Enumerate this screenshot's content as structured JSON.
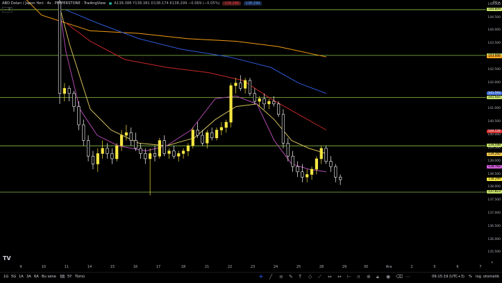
{
  "legend": {
    "symbol": "ABD Doları / Japon Yeni · 4s · PEPPERSTONE · TradingView",
    "ohlc": "A138.388 Y138.381 D138.174 K138.299 −0.069 (−0.05%)",
    "sell": "138.288",
    "buy": "138.299"
  },
  "collapse_label": "⌄ 3",
  "axis_symbol": "JPY ▾",
  "price_ticks": [
    "145.000",
    "144.500",
    "144.000",
    "143.500",
    "143.000",
    "142.500",
    "142.000",
    "141.500",
    "141.000",
    "140.500",
    "140.000",
    "139.500",
    "139.000",
    "138.500",
    "138.000",
    "137.500",
    "137.000",
    "136.500",
    "136.000",
    "135.500"
  ],
  "price_tags": [
    {
      "text": "144.809",
      "color": "#c6e06a",
      "fg": "#000"
    },
    {
      "text": "143.059",
      "color": "#c6e06a",
      "fg": "#000"
    },
    {
      "text": "143.006",
      "color": "#f5a623",
      "fg": "#000"
    },
    {
      "text": "141.593",
      "color": "#3f6fd9",
      "fg": "#fff"
    },
    {
      "text": "141.445",
      "color": "#c6e06a",
      "fg": "#000"
    },
    {
      "text": "140.128",
      "color": "#d32f2f",
      "fg": "#fff"
    },
    {
      "text": "139.598",
      "color": "#c6e06a",
      "fg": "#000"
    },
    {
      "text": "139.260",
      "color": "#f2c94c",
      "fg": "#000"
    },
    {
      "text": "138.782",
      "color": "#ce5cd6",
      "fg": "#000"
    },
    {
      "text": "138.299",
      "color": "#f5e642",
      "fg": "#000"
    },
    {
      "text": "137.823",
      "color": "#c6e06a",
      "fg": "#000"
    }
  ],
  "time_ticks": [
    "9",
    "10",
    "11",
    "14",
    "15",
    "16",
    "17",
    "18",
    "21",
    "22",
    "23",
    "24",
    "25",
    "28",
    "29",
    "30",
    "Ara",
    "2",
    "5",
    "6",
    "7"
  ],
  "bottom": {
    "ranges": [
      "1G",
      "5G",
      "1A",
      "3A",
      "6A",
      "Bu sene",
      "1Y",
      "5Y",
      "Tümü"
    ],
    "clock": "09:15:19 (UTC+3)",
    "percent": "%",
    "log": "log",
    "auto": "otomatik"
  },
  "colors": {
    "up": "#f5e642",
    "down": "#ffffff",
    "hline": "#8bc34a",
    "ma_orange": "#f39c12",
    "ma_blue": "#2e5bd8",
    "ma_red": "#c62828",
    "ma_yellow": "#d4c05a",
    "ma_purple": "#b04ab0"
  },
  "chart_data": {
    "type": "candlestick",
    "title": "ABD Doları / Japon Yeni · 4s · PEPPERSTONE",
    "y_range": [
      135.3,
      145.1
    ],
    "horizontal_lines": [
      144.809,
      143.059,
      141.445,
      139.598,
      137.823
    ],
    "candles": [
      [
        145.1,
        145.2,
        141.2,
        141.6
      ],
      [
        141.6,
        142.0,
        141.3,
        141.8
      ],
      [
        141.8,
        141.9,
        141.3,
        141.6
      ],
      [
        141.6,
        141.7,
        140.9,
        141.1
      ],
      [
        141.1,
        141.3,
        140.2,
        140.4
      ],
      [
        140.4,
        140.6,
        139.6,
        139.8
      ],
      [
        139.8,
        140.0,
        139.0,
        139.2
      ],
      [
        139.2,
        139.4,
        138.7,
        138.9
      ],
      [
        138.9,
        139.5,
        138.6,
        139.3
      ],
      [
        139.3,
        139.8,
        139.1,
        139.5
      ],
      [
        139.5,
        139.7,
        139.1,
        139.3
      ],
      [
        139.3,
        139.5,
        138.9,
        139.1
      ],
      [
        139.1,
        139.7,
        139.0,
        139.6
      ],
      [
        139.6,
        140.2,
        139.4,
        140.0
      ],
      [
        140.0,
        140.4,
        139.8,
        140.1
      ],
      [
        140.1,
        140.3,
        139.6,
        139.8
      ],
      [
        139.8,
        140.1,
        139.4,
        139.5
      ],
      [
        139.5,
        139.7,
        139.1,
        139.3
      ],
      [
        139.3,
        139.5,
        138.9,
        139.1
      ],
      [
        139.1,
        139.5,
        137.7,
        139.3
      ],
      [
        139.3,
        139.6,
        139.0,
        139.2
      ],
      [
        139.2,
        139.9,
        139.1,
        139.8
      ],
      [
        139.8,
        140.0,
        139.2,
        139.3
      ],
      [
        139.3,
        139.5,
        139.1,
        139.4
      ],
      [
        139.4,
        139.6,
        139.1,
        139.2
      ],
      [
        139.2,
        139.4,
        139.0,
        139.3
      ],
      [
        139.3,
        139.5,
        139.1,
        139.4
      ],
      [
        139.4,
        139.7,
        139.2,
        139.6
      ],
      [
        139.6,
        140.3,
        139.5,
        140.2
      ],
      [
        140.2,
        140.5,
        139.9,
        140.0
      ],
      [
        140.0,
        140.2,
        139.6,
        139.7
      ],
      [
        139.7,
        140.2,
        139.5,
        140.1
      ],
      [
        140.1,
        140.3,
        139.8,
        139.9
      ],
      [
        139.9,
        140.3,
        139.8,
        140.2
      ],
      [
        140.2,
        140.5,
        140.0,
        140.3
      ],
      [
        140.3,
        140.6,
        140.1,
        140.5
      ],
      [
        140.5,
        142.0,
        140.3,
        141.9
      ],
      [
        141.9,
        142.2,
        141.6,
        142.0
      ],
      [
        142.0,
        142.3,
        141.7,
        141.8
      ],
      [
        141.8,
        142.2,
        141.6,
        142.1
      ],
      [
        142.1,
        142.2,
        141.5,
        141.6
      ],
      [
        141.6,
        141.8,
        141.2,
        141.3
      ],
      [
        141.3,
        141.5,
        141.1,
        141.4
      ],
      [
        141.4,
        141.6,
        141.0,
        141.2
      ],
      [
        141.2,
        141.4,
        141.0,
        141.3
      ],
      [
        141.3,
        141.5,
        141.1,
        141.2
      ],
      [
        141.2,
        141.3,
        140.7,
        140.8
      ],
      [
        140.8,
        141.0,
        139.5,
        139.7
      ],
      [
        139.7,
        139.9,
        139.0,
        139.2
      ],
      [
        139.2,
        139.4,
        138.6,
        138.8
      ],
      [
        138.8,
        139.0,
        138.4,
        138.6
      ],
      [
        138.6,
        138.9,
        138.2,
        138.4
      ],
      [
        138.4,
        138.7,
        138.2,
        138.5
      ],
      [
        138.5,
        138.8,
        138.3,
        138.7
      ],
      [
        138.7,
        139.2,
        138.5,
        139.1
      ],
      [
        139.1,
        139.6,
        138.9,
        139.5
      ],
      [
        139.5,
        139.6,
        138.9,
        139.0
      ],
      [
        139.0,
        139.2,
        138.6,
        138.8
      ],
      [
        138.8,
        138.9,
        138.2,
        138.4
      ],
      [
        138.4,
        138.5,
        138.1,
        138.3
      ]
    ],
    "moving_averages": [
      {
        "color": "#f39c12",
        "values": [
          [
            0,
            146.2
          ],
          [
            60,
            144.6
          ],
          [
            130,
            144.0
          ],
          [
            200,
            143.9
          ],
          [
            270,
            143.7
          ],
          [
            340,
            143.6
          ],
          [
            400,
            143.4
          ],
          [
            470,
            143.0
          ]
        ]
      },
      {
        "color": "#2e5bd8",
        "values": [
          [
            95,
            144.8
          ],
          [
            140,
            144.3
          ],
          [
            200,
            143.7
          ],
          [
            260,
            143.3
          ],
          [
            330,
            143.0
          ],
          [
            390,
            142.6
          ],
          [
            430,
            142.0
          ],
          [
            470,
            141.6
          ]
        ]
      },
      {
        "color": "#c62828",
        "values": [
          [
            95,
            144.3
          ],
          [
            130,
            143.6
          ],
          [
            180,
            142.9
          ],
          [
            240,
            142.6
          ],
          [
            300,
            142.4
          ],
          [
            350,
            142.1
          ],
          [
            390,
            141.4
          ],
          [
            430,
            140.8
          ],
          [
            470,
            140.2
          ]
        ]
      },
      {
        "color": "#d4c05a",
        "values": [
          [
            85,
            145.0
          ],
          [
            100,
            143.5
          ],
          [
            130,
            141.0
          ],
          [
            160,
            140.2
          ],
          [
            200,
            139.7
          ],
          [
            240,
            139.6
          ],
          [
            280,
            139.9
          ],
          [
            310,
            140.6
          ],
          [
            340,
            141.1
          ],
          [
            370,
            141.2
          ],
          [
            395,
            140.6
          ],
          [
            420,
            139.8
          ],
          [
            445,
            139.5
          ],
          [
            470,
            139.3
          ]
        ]
      },
      {
        "color": "#b04ab0",
        "values": [
          [
            85,
            145.0
          ],
          [
            95,
            143.2
          ],
          [
            115,
            141.0
          ],
          [
            140,
            140.0
          ],
          [
            170,
            139.6
          ],
          [
            210,
            139.4
          ],
          [
            240,
            139.6
          ],
          [
            275,
            140.2
          ],
          [
            310,
            141.4
          ],
          [
            340,
            141.5
          ],
          [
            370,
            141.2
          ],
          [
            395,
            139.8
          ],
          [
            420,
            138.9
          ],
          [
            445,
            138.7
          ],
          [
            470,
            138.6
          ]
        ]
      }
    ]
  }
}
